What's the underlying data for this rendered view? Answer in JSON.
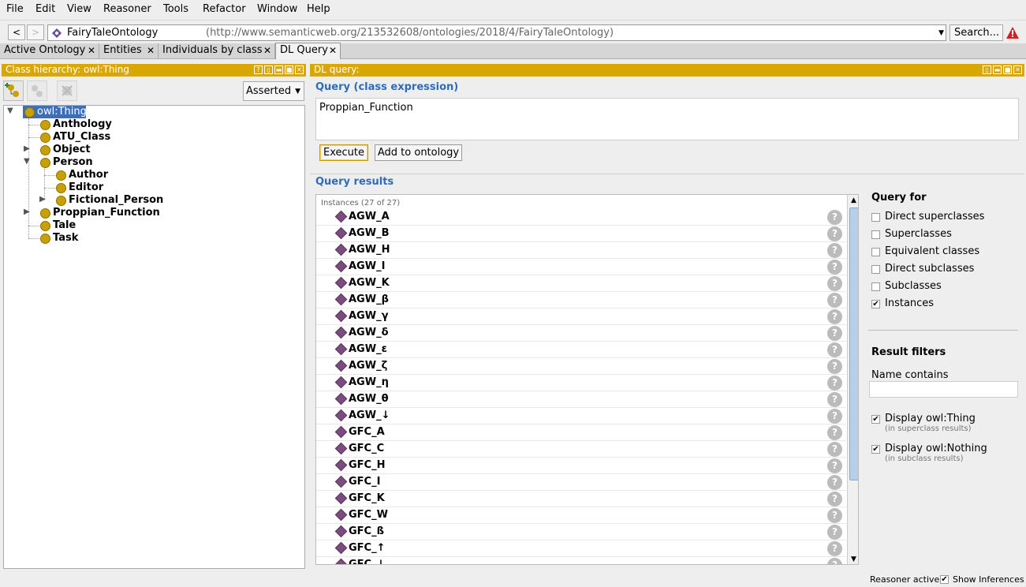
{
  "menu": [
    "File",
    "Edit",
    "View",
    "Reasoner",
    "Tools",
    "Refactor",
    "Window",
    "Help"
  ],
  "address": {
    "back_label": "<",
    "forward_label": ">",
    "ontology_name": "FairyTaleOntology",
    "ontology_iri": "(http://www.semanticweb.org/213532608/ontologies/2018/4/FairyTaleOntology)",
    "search_label": "Search...",
    "icon": "ontology-diamond-icon",
    "warning_icon": "warning-triangle-icon"
  },
  "tabs": [
    {
      "label": "Active Ontology"
    },
    {
      "label": "Entities"
    },
    {
      "label": "Individuals by class"
    },
    {
      "label": "DL Query"
    }
  ],
  "tab_close_glyph": "✕",
  "left": {
    "title": "Class hierarchy: owl:Thing",
    "view_mode": "Asserted",
    "tree": {
      "root": "owl:Thing",
      "anthology": "Anthology",
      "atu_class": "ATU_Class",
      "object": "Object",
      "person": "Person",
      "author": "Author",
      "editor": "Editor",
      "fictional_person": "Fictional_Person",
      "proppian_function": "Proppian_Function",
      "tale": "Tale",
      "task": "Task"
    }
  },
  "right": {
    "title": "DL query:",
    "query_section": "Query (class expression)",
    "query_text": "Proppian_Function",
    "execute_label": "Execute",
    "add_label": "Add to ontology",
    "results_section": "Query results",
    "results_header": "Instances (27 of 27)",
    "results": [
      "AGW_A",
      "AGW_B",
      "AGW_H",
      "AGW_I",
      "AGW_K",
      "AGW_β",
      "AGW_γ",
      "AGW_δ",
      "AGW_ε",
      "AGW_ζ",
      "AGW_η",
      "AGW_θ",
      "AGW_↓",
      "GFC_A",
      "GFC_C",
      "GFC_H",
      "GFC_I",
      "GFC_K",
      "GFC_W",
      "GFC_ß",
      "GFC_↑",
      "GFC_↓"
    ],
    "help_glyph": "?",
    "query_for": {
      "title": "Query for",
      "options": [
        {
          "label": "Direct superclasses",
          "checked": false
        },
        {
          "label": "Superclasses",
          "checked": false
        },
        {
          "label": "Equivalent classes",
          "checked": false
        },
        {
          "label": "Direct subclasses",
          "checked": false
        },
        {
          "label": "Subclasses",
          "checked": false
        },
        {
          "label": "Instances",
          "checked": true
        }
      ]
    },
    "filters": {
      "title": "Result filters",
      "name_contains_label": "Name contains",
      "name_contains_value": "",
      "display_thing_label": "Display owl:Thing",
      "display_thing_sub": "(in superclass results)",
      "display_thing_checked": true,
      "display_nothing_label": "Display owl:Nothing",
      "display_nothing_sub": "(in subclass results)",
      "display_nothing_checked": true
    }
  },
  "status": {
    "reasoner": "Reasoner active",
    "show_inferences": "Show Inferences",
    "show_inferences_checked": true
  },
  "colors": {
    "header": "#d9a800",
    "class_icon": "#c8a000",
    "individual_icon": "#7a4d7e",
    "section_title": "#2f6cb8",
    "selection": "#3d6fb8"
  }
}
